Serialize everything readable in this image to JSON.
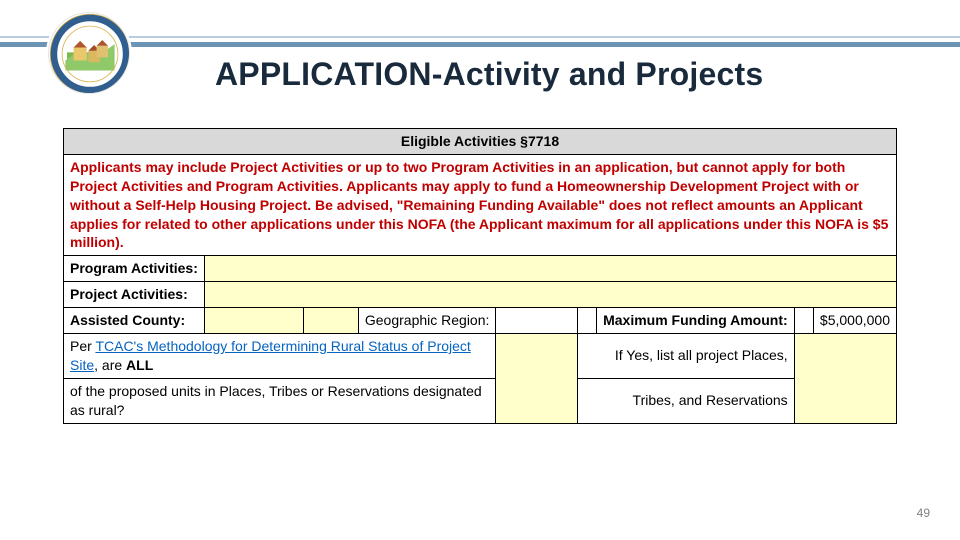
{
  "header": {
    "title": "APPLICATION-Activity and Projects"
  },
  "form": {
    "section_title": "Eligible Activities §7718",
    "notice": "Applicants may include Project Activities or up to two Program Activities in an application, but cannot apply for both Project Activities and Program Activities. Applicants may apply to fund a Homeownership Development Project with or without a Self-Help Housing Project. Be advised, \"Remaining Funding Available\" does not reflect amounts an Applicant applies for related to other applications under this NOFA (the Applicant maximum for all applications under this NOFA is $5 million).",
    "program_activities_label": "Program Activities:",
    "project_activities_label": "Project Activities:",
    "assisted_county_label": "Assisted County:",
    "geographic_region_label": "Geographic Region:",
    "max_funding_label": "Maximum Funding Amount:",
    "max_funding_value": "$5,000,000",
    "rural_q_prefix": "Per ",
    "rural_q_link": "TCAC's Methodology for Determining Rural Status of Project Site",
    "rural_q_mid1": ", are ",
    "rural_q_all": "ALL",
    "rural_q_line2": "of the proposed units in Places, Tribes or Reservations designated as rural?",
    "rural_list_line1": "If Yes, list all project Places,",
    "rural_list_line2": "Tribes, and Reservations"
  },
  "page_number": "49"
}
